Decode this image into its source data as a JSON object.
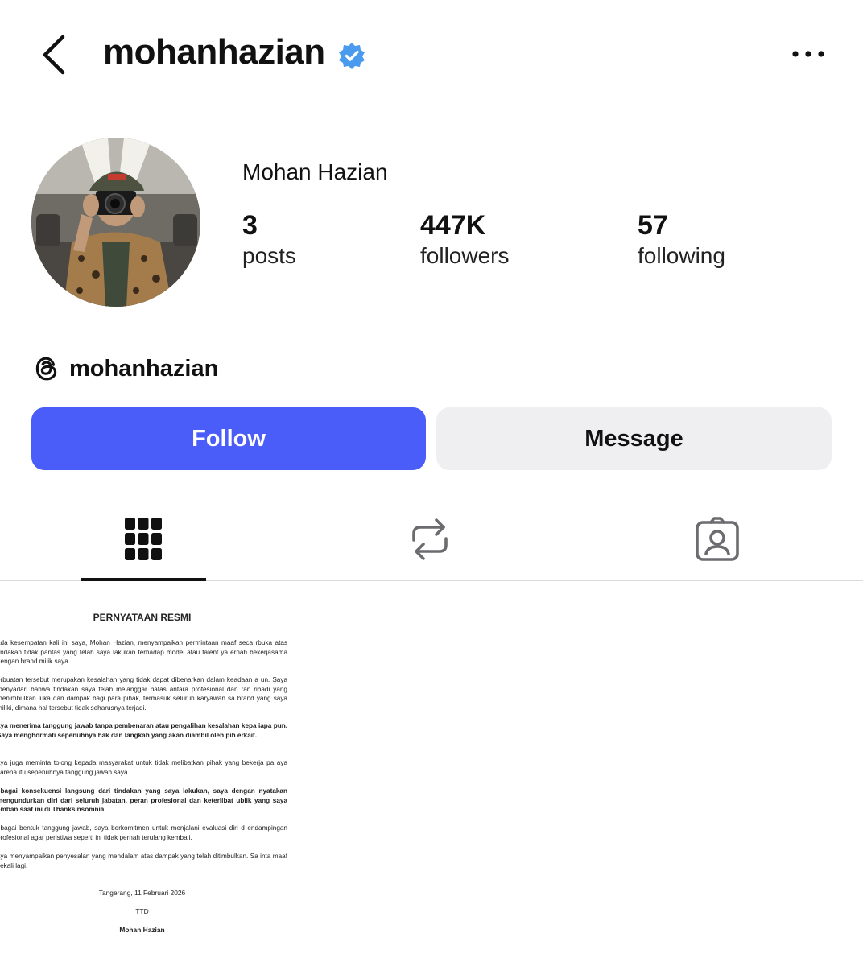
{
  "header": {
    "username": "mohanhazian",
    "verified": true,
    "back_icon": "chevron-left-icon",
    "more_icon": "more-horizontal-icon"
  },
  "profile": {
    "display_name": "Mohan Hazian",
    "avatar_icon": "profile-photo",
    "stats": [
      {
        "value": "3",
        "label": "posts"
      },
      {
        "value": "447K",
        "label": "followers"
      },
      {
        "value": "57",
        "label": "following"
      }
    ],
    "threads": {
      "icon": "threads-icon",
      "handle": "mohanhazian"
    }
  },
  "actions": {
    "follow_label": "Follow",
    "message_label": "Message",
    "follow_color": "#4a5df9",
    "message_color": "#efeff2"
  },
  "tabs": [
    {
      "icon": "grid-icon",
      "active": true
    },
    {
      "icon": "repost-icon",
      "active": false
    },
    {
      "icon": "tagged-icon",
      "active": false
    }
  ],
  "post": {
    "title": "PERNYATAAN RESMI",
    "paragraphs": [
      {
        "bold": false,
        "text": "ada kesempatan kali ini saya, Mohan Hazian, menyampaikan permintaan maaf seca rbuka atas tindakan tidak pantas yang telah saya lakukan terhadap model atau talent ya ernah bekerjasama dengan brand milik saya."
      },
      {
        "bold": false,
        "text": "erbuatan tersebut merupakan kesalahan yang tidak dapat dibenarkan dalam keadaan a un. Saya menyadari bahwa tindakan saya telah melanggar batas antara profesional dan ran ribadi yang menimbulkan luka dan dampak bagi para pihak, termasuk seluruh karyawan sa brand yang saya miliki, dimana hal tersebut tidak seharusnya terjadi."
      },
      {
        "bold": true,
        "text": "aya menerima tanggung jawab tanpa pembenaran atau pengalihan kesalahan kepa iapa pun. Saya menghormati sepenuhnya hak dan langkah yang akan diambil oleh pih erkait."
      },
      {
        "bold": false,
        "text": "aya juga meminta tolong kepada masyarakat untuk tidak melibatkan pihak yang bekerja pa aya karena itu sepenuhnya tanggung jawab saya."
      },
      {
        "bold": true,
        "text": "ebagai konsekuensi langsung dari tindakan yang saya lakukan, saya dengan nyatakan mengundurkan diri dari seluruh jabatan, peran profesional dan keterlibat ublik yang saya emban saat ini di Thanksinsomnia."
      },
      {
        "bold": false,
        "text": "ebagai bentuk tanggung jawab, saya berkomitmen untuk menjalani evaluasi diri d endampingan profesional agar peristiwa seperti ini tidak pernah terulang kembali."
      },
      {
        "bold": false,
        "text": "aya menyampaikan penyesalan yang mendalam atas dampak yang telah ditimbulkan. Sa inta maaf sekali lagi."
      }
    ],
    "place_date": "Tangerang, 11 Februari 2026",
    "ttd": "TTD",
    "signer": "Mohan Hazian"
  }
}
